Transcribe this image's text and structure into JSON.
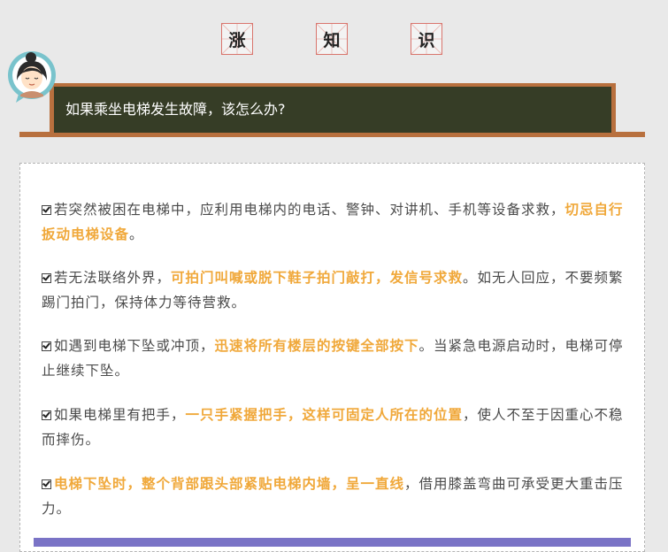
{
  "title_chars": [
    "涨",
    "知",
    "识"
  ],
  "colors": {
    "background": "#e9e9e9",
    "banner_border": "#b8703e",
    "banner_fill": "#363d26",
    "highlight": "#f0a83a",
    "body_text": "#4a4a4a",
    "title_char_border": "#d9756d",
    "bottom_bar": "#7a73c6"
  },
  "avatar_icon": "cartoon-woman-avatar",
  "question": "如果乘坐电梯发生故障，该怎么办?",
  "tips": [
    {
      "pre": "若突然被困在电梯中，应利用电梯内的电话、警钟、对讲机、手机等设备求救，",
      "hl": "切忌自行扳动电梯设备",
      "post": "。"
    },
    {
      "pre": "若无法联络外界，",
      "hl": "可拍门叫喊或脱下鞋子拍门敲打，发信号求救",
      "post": "。如无人回应，不要频繁踢门拍门，保持体力等待营救。"
    },
    {
      "pre": "如遇到电梯下坠或冲顶，",
      "hl": "迅速将所有楼层的按键全部按下",
      "post": "。当紧急电源启动时，电梯可停止继续下坠。"
    },
    {
      "pre": "如果电梯里有把手，",
      "hl": "一只手紧握把手，这样可固定人所在的位置",
      "post": "，使人不至于因重心不稳而摔伤。"
    },
    {
      "pre": "",
      "hl": "电梯下坠时，整个背部跟头部紧贴电梯内墙，呈一直线",
      "post": "，借用膝盖弯曲可承受更大重击压力。"
    }
  ]
}
